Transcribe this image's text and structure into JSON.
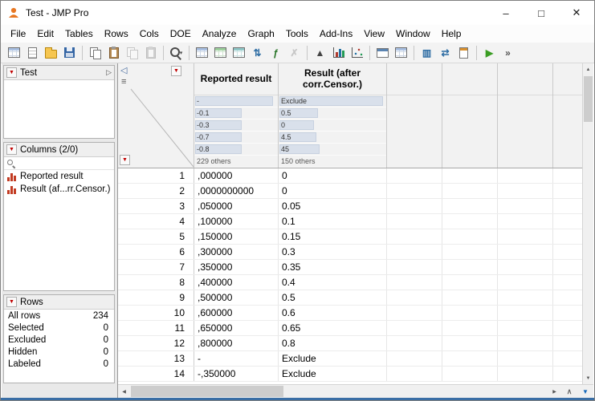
{
  "colors": {
    "accent_red": "#c00000",
    "bottom_accent": "#3a6ea5",
    "preview_bar": "#d9e0eb"
  },
  "icons": {
    "red_triangle": "▼",
    "collapse_left": "◁",
    "header_menu": "≡",
    "panel_expand": "▷",
    "scroll_up": "▲",
    "scroll_down": "▼",
    "scroll_left": "◀",
    "scroll_right": "▶",
    "jump_top": "∧",
    "bottom_menu": "▼"
  },
  "window": {
    "title": "Test - JMP Pro",
    "minimize": "–",
    "maximize": "□",
    "close": "✕"
  },
  "menu": {
    "items": [
      "File",
      "Edit",
      "Tables",
      "Rows",
      "Cols",
      "DOE",
      "Analyze",
      "Graph",
      "Tools",
      "Add-Ins",
      "View",
      "Window",
      "Help"
    ]
  },
  "toolbar": {
    "items": [
      {
        "name": "new-data-table",
        "kind": "table"
      },
      {
        "name": "new-journal",
        "kind": "doc"
      },
      {
        "name": "open",
        "kind": "folder"
      },
      {
        "name": "save",
        "kind": "save"
      },
      {
        "sep": true
      },
      {
        "name": "copy",
        "kind": "copy"
      },
      {
        "name": "paste",
        "kind": "paste"
      },
      {
        "name": "copy-with-names",
        "kind": "copy",
        "disabled": true
      },
      {
        "name": "paste-with-names",
        "kind": "paste",
        "disabled": true
      },
      {
        "sep": true
      },
      {
        "name": "zoom",
        "kind": "zoom",
        "dropdown": true
      },
      {
        "sep": true
      },
      {
        "name": "summary",
        "kind": "table"
      },
      {
        "name": "subset",
        "kind": "table-green"
      },
      {
        "name": "join",
        "kind": "table-teal"
      },
      {
        "name": "sort",
        "kind": "glyph",
        "glyph": "⇅",
        "color": "#2e6da4"
      },
      {
        "name": "formula-editor",
        "kind": "glyph",
        "glyph": "ƒ",
        "color": "#267326"
      },
      {
        "name": "clear-formula",
        "kind": "glyph",
        "glyph": "✗",
        "color": "#777",
        "disabled": true
      },
      {
        "sep": true
      },
      {
        "name": "sort-ascending",
        "kind": "glyph",
        "glyph": "▲",
        "color": "#444"
      },
      {
        "name": "distribution",
        "kind": "chart"
      },
      {
        "name": "fit-y-by-x",
        "kind": "scatter"
      },
      {
        "sep": true
      },
      {
        "name": "graph-builder",
        "kind": "window"
      },
      {
        "name": "tabulate",
        "kind": "table"
      },
      {
        "sep": true
      },
      {
        "name": "data-filter",
        "kind": "glyph",
        "glyph": "▥",
        "color": "#2e6da4"
      },
      {
        "name": "column-switcher",
        "kind": "glyph",
        "glyph": "⇄",
        "color": "#2e6da4"
      },
      {
        "name": "journal",
        "kind": "journal"
      },
      {
        "sep": true
      },
      {
        "name": "run-script",
        "kind": "glyph",
        "glyph": "▶",
        "color": "#3a9d23"
      },
      {
        "name": "toolbar-options",
        "kind": "glyph",
        "glyph": "»",
        "color": "#555"
      }
    ]
  },
  "sidebar": {
    "test_panel": {
      "title": "Test"
    },
    "columns_panel": {
      "title": "Columns (2/0)",
      "search_placeholder": "",
      "items": [
        {
          "label": "Reported result"
        },
        {
          "label": "Result (af...rr.Censor.)"
        }
      ]
    },
    "rows_panel": {
      "title": "Rows",
      "stats": [
        [
          "All rows",
          "234"
        ],
        [
          "Selected",
          "0"
        ],
        [
          "Excluded",
          "0"
        ],
        [
          "Hidden",
          "0"
        ],
        [
          "Labeled",
          "0"
        ]
      ]
    }
  },
  "table": {
    "columns": [
      {
        "header": "Reported result",
        "preview": [
          [
            "-",
            93
          ],
          [
            "-0.1",
            56
          ],
          [
            "-0.3",
            56
          ],
          [
            "-0.7",
            56
          ],
          [
            "-0.8",
            56
          ],
          [
            "229 others",
            0
          ]
        ]
      },
      {
        "header": "Result (after corr.Censor.)",
        "preview": [
          [
            "Exclude",
            96
          ],
          [
            "0.5",
            36
          ],
          [
            "0",
            32
          ],
          [
            "4.5",
            34
          ],
          [
            "45",
            37
          ],
          [
            "150 others",
            0
          ]
        ]
      }
    ],
    "rows": [
      [
        "1",
        ",000000",
        "0"
      ],
      [
        "2",
        ",0000000000",
        "0"
      ],
      [
        "3",
        ",050000",
        "0.05"
      ],
      [
        "4",
        ",100000",
        "0.1"
      ],
      [
        "5",
        ",150000",
        "0.15"
      ],
      [
        "6",
        ",300000",
        "0.3"
      ],
      [
        "7",
        ",350000",
        "0.35"
      ],
      [
        "8",
        ",400000",
        "0.4"
      ],
      [
        "9",
        ",500000",
        "0.5"
      ],
      [
        "10",
        ",600000",
        "0.6"
      ],
      [
        "11",
        ",650000",
        "0.65"
      ],
      [
        "12",
        ",800000",
        "0.8"
      ],
      [
        "13",
        "-",
        "Exclude"
      ],
      [
        "14",
        "-,350000",
        "Exclude"
      ]
    ]
  }
}
